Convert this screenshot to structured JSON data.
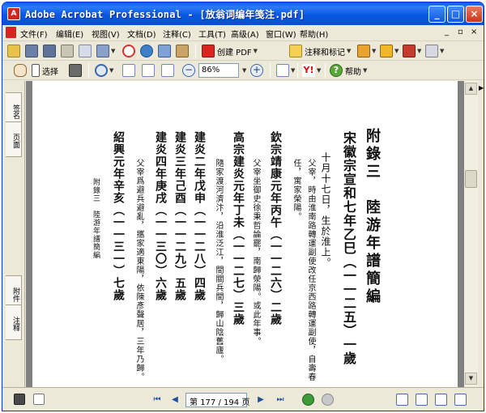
{
  "window": {
    "title": "Adobe Acrobat Professional - [放翁词编年笺注.pdf]",
    "icon_text": "A",
    "controls": [
      "minimize-icon",
      "maximize-icon",
      "close-icon"
    ]
  },
  "menubar": {
    "items": [
      {
        "label": "文件(F)"
      },
      {
        "label": "编辑(E)"
      },
      {
        "label": "视图(V)"
      },
      {
        "label": "文档(D)"
      },
      {
        "label": "注释(C)"
      },
      {
        "label": "工具(T)"
      },
      {
        "label": "高级(A)"
      },
      {
        "label": "窗口(W)"
      },
      {
        "label": "帮助(H)"
      }
    ],
    "right_controls": [
      "_",
      "▫",
      "×"
    ]
  },
  "toolbar1": {
    "create_pdf_label": "创建 PDF",
    "comment_label": "注释和标记"
  },
  "toolbar2": {
    "select_label": "选择",
    "zoom_value": "86%",
    "help_label": "帮助"
  },
  "leftnav": {
    "tabs": [
      "签名",
      "页面",
      "附件",
      "注释"
    ]
  },
  "page": {
    "title": "附錄三　陸游年譜簡編",
    "margin_label": "附錄三　陸游年譜簡編",
    "columns": [
      {
        "text": "宋徽宗宣和七年乙巳（一一二五）一歲",
        "size": 16,
        "bold": true
      },
      {
        "text": "十月十七日，生於淮上。",
        "size": 12,
        "bold": false
      },
      {
        "text": "父宰，時由淮南路轉運副使改任京西路轉運副使，自壽春",
        "size": 10,
        "bold": false
      },
      {
        "text": "任，寓家榮陽。",
        "size": 10,
        "bold": false
      },
      {
        "text": "欽宗靖康元年丙午（一一二六）二歲",
        "size": 14,
        "bold": true
      },
      {
        "text": "父宰坐御史徐秉哲論罷，南歸滎陽。或此年事。",
        "size": 10,
        "bold": false
      },
      {
        "text": "高宗建炎元年丁未（一一二七）三歲",
        "size": 14,
        "bold": true
      },
      {
        "text": "隨家渡河濟汴，沿淮泛江，間關兵間，歸山陰舊廬。",
        "size": 10,
        "bold": false
      },
      {
        "text": "建炎二年戊申（一一二八）四歲",
        "size": 14,
        "bold": true
      },
      {
        "text": "建炎三年己酉（一一二九）五歲",
        "size": 14,
        "bold": true
      },
      {
        "text": "建炎四年庚戌（一一三〇）六歲",
        "size": 14,
        "bold": true
      },
      {
        "text": "父宰爲避兵避亂，攜家適東陽，依陳彥聲居，三年乃歸。",
        "size": 10,
        "bold": false
      },
      {
        "text": "紹興元年辛亥（一一三一）七歲",
        "size": 14,
        "bold": true
      }
    ]
  },
  "statusbar": {
    "page_prefix": "第",
    "current_page": "177",
    "page_separator": "/",
    "total_pages": "194",
    "page_suffix": "页"
  },
  "colors": {
    "titlebar": "#0a58e0",
    "page_bg": "#ffffff",
    "doc_bg": "#808080",
    "chrome": "#ece9d8"
  }
}
